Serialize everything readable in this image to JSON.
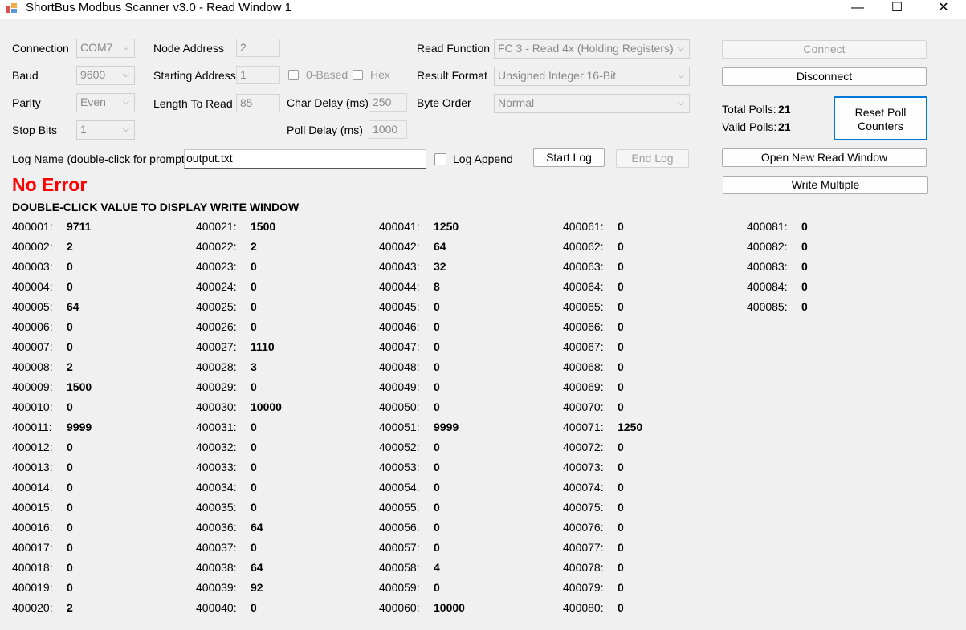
{
  "window": {
    "title": "ShortBus Modbus Scanner v3.0 - Read Window 1",
    "minimize": "—",
    "maximize": "☐",
    "close": "✕"
  },
  "settings": {
    "connection_label": "Connection",
    "connection_value": "COM7",
    "baud_label": "Baud",
    "baud_value": "9600",
    "parity_label": "Parity",
    "parity_value": "Even",
    "stop_bits_label": "Stop Bits",
    "stop_bits_value": "1",
    "node_address_label": "Node Address",
    "node_address_value": "2",
    "starting_address_label": "Starting Address",
    "starting_address_value": "1",
    "zero_based_label": "0-Based",
    "hex_label": "Hex",
    "length_label": "Length To Read",
    "length_value": "85",
    "char_delay_label": "Char Delay (ms)",
    "char_delay_value": "250",
    "poll_delay_label": "Poll Delay (ms)",
    "poll_delay_value": "1000",
    "read_function_label": "Read Function",
    "read_function_value": "FC 3 - Read 4x (Holding Registers)",
    "result_format_label": "Result Format",
    "result_format_value": "Unsigned Integer 16-Bit",
    "byte_order_label": "Byte Order",
    "byte_order_value": "Normal"
  },
  "buttons": {
    "connect": "Connect",
    "disconnect": "Disconnect",
    "reset_poll_line1": "Reset Poll",
    "reset_poll_line2": "Counters",
    "open_new_read_window": "Open New Read Window",
    "write_multiple": "Write Multiple",
    "start_log": "Start Log",
    "end_log": "End Log"
  },
  "polls": {
    "total_label": "Total Polls:",
    "total_value": "21",
    "valid_label": "Valid Polls:",
    "valid_value": "21"
  },
  "log": {
    "name_label": "Log Name (double-click for prompt)",
    "name_value": "output.txt",
    "append_label": "Log Append"
  },
  "status": {
    "error_text": "No Error",
    "banner": "DOUBLE-CLICK VALUE TO DISPLAY WRITE WINDOW"
  },
  "registers": [
    [
      [
        "400001:",
        "9711"
      ],
      [
        "400002:",
        "2"
      ],
      [
        "400003:",
        "0"
      ],
      [
        "400004:",
        "0"
      ],
      [
        "400005:",
        "64"
      ],
      [
        "400006:",
        "0"
      ],
      [
        "400007:",
        "0"
      ],
      [
        "400008:",
        "2"
      ],
      [
        "400009:",
        "1500"
      ],
      [
        "400010:",
        "0"
      ],
      [
        "400011:",
        "9999"
      ],
      [
        "400012:",
        "0"
      ],
      [
        "400013:",
        "0"
      ],
      [
        "400014:",
        "0"
      ],
      [
        "400015:",
        "0"
      ],
      [
        "400016:",
        "0"
      ],
      [
        "400017:",
        "0"
      ],
      [
        "400018:",
        "0"
      ],
      [
        "400019:",
        "0"
      ],
      [
        "400020:",
        "2"
      ]
    ],
    [
      [
        "400021:",
        "1500"
      ],
      [
        "400022:",
        "2"
      ],
      [
        "400023:",
        "0"
      ],
      [
        "400024:",
        "0"
      ],
      [
        "400025:",
        "0"
      ],
      [
        "400026:",
        "0"
      ],
      [
        "400027:",
        "1110"
      ],
      [
        "400028:",
        "3"
      ],
      [
        "400029:",
        "0"
      ],
      [
        "400030:",
        "10000"
      ],
      [
        "400031:",
        "0"
      ],
      [
        "400032:",
        "0"
      ],
      [
        "400033:",
        "0"
      ],
      [
        "400034:",
        "0"
      ],
      [
        "400035:",
        "0"
      ],
      [
        "400036:",
        "64"
      ],
      [
        "400037:",
        "0"
      ],
      [
        "400038:",
        "64"
      ],
      [
        "400039:",
        "92"
      ],
      [
        "400040:",
        "0"
      ]
    ],
    [
      [
        "400041:",
        "1250"
      ],
      [
        "400042:",
        "64"
      ],
      [
        "400043:",
        "32"
      ],
      [
        "400044:",
        "8"
      ],
      [
        "400045:",
        "0"
      ],
      [
        "400046:",
        "0"
      ],
      [
        "400047:",
        "0"
      ],
      [
        "400048:",
        "0"
      ],
      [
        "400049:",
        "0"
      ],
      [
        "400050:",
        "0"
      ],
      [
        "400051:",
        "9999"
      ],
      [
        "400052:",
        "0"
      ],
      [
        "400053:",
        "0"
      ],
      [
        "400054:",
        "0"
      ],
      [
        "400055:",
        "0"
      ],
      [
        "400056:",
        "0"
      ],
      [
        "400057:",
        "0"
      ],
      [
        "400058:",
        "4"
      ],
      [
        "400059:",
        "0"
      ],
      [
        "400060:",
        "10000"
      ]
    ],
    [
      [
        "400061:",
        "0"
      ],
      [
        "400062:",
        "0"
      ],
      [
        "400063:",
        "0"
      ],
      [
        "400064:",
        "0"
      ],
      [
        "400065:",
        "0"
      ],
      [
        "400066:",
        "0"
      ],
      [
        "400067:",
        "0"
      ],
      [
        "400068:",
        "0"
      ],
      [
        "400069:",
        "0"
      ],
      [
        "400070:",
        "0"
      ],
      [
        "400071:",
        "1250"
      ],
      [
        "400072:",
        "0"
      ],
      [
        "400073:",
        "0"
      ],
      [
        "400074:",
        "0"
      ],
      [
        "400075:",
        "0"
      ],
      [
        "400076:",
        "0"
      ],
      [
        "400077:",
        "0"
      ],
      [
        "400078:",
        "0"
      ],
      [
        "400079:",
        "0"
      ],
      [
        "400080:",
        "0"
      ]
    ],
    [
      [
        "400081:",
        "0"
      ],
      [
        "400082:",
        "0"
      ],
      [
        "400083:",
        "0"
      ],
      [
        "400084:",
        "0"
      ],
      [
        "400085:",
        "0"
      ]
    ]
  ]
}
